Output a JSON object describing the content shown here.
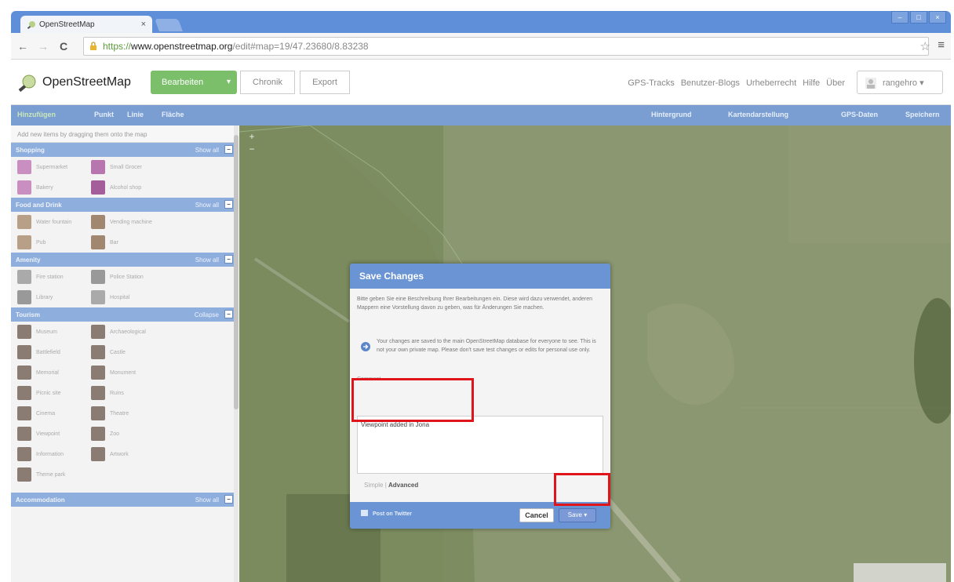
{
  "browser": {
    "tab_title": "OpenStreetMap",
    "tab_close": "×",
    "url_scheme": "https://",
    "url_domain": "www.openstreetmap.org",
    "url_rest": "/edit#map=19/47.23680/8.83238",
    "back": "←",
    "forward": "→",
    "reload": "C",
    "bookmark_star": "☆",
    "menu": "≡",
    "window_buttons": [
      "–",
      "□",
      "×"
    ]
  },
  "osm_header": {
    "brand": "OpenStreetMap",
    "edit_label": "Bearbeiten",
    "edit_caret": "▾",
    "history_label": "Chronik",
    "export_label": "Export",
    "links": [
      "GPS-Tracks",
      "Benutzer-Blogs",
      "Urheberrecht",
      "Hilfe",
      "Über"
    ],
    "user": "rangehro ▾"
  },
  "editor_bar": {
    "left": [
      "Hinzufügen",
      "Punkt",
      "Linie",
      "Fläche"
    ],
    "right": [
      "Hintergrund",
      "Kartendarstellung",
      "GPS-Daten",
      "Speichern"
    ]
  },
  "sidebar": {
    "hint": "Add new items by dragging them onto the map",
    "show_all": "Show all",
    "collapse": "−",
    "categories": [
      {
        "name": "Shopping",
        "items": [
          [
            "Supermarket",
            "Small Grocer"
          ],
          [
            "Bakery",
            "Alcohol shop"
          ]
        ]
      },
      {
        "name": "Food and Drink",
        "items": [
          [
            "Water fountain",
            "Vending machine"
          ],
          [
            "Pub",
            "Bar"
          ]
        ]
      },
      {
        "name": "Amenity",
        "items": [
          [
            "Fire station",
            "Police Station"
          ],
          [
            "Library",
            "Hospital"
          ]
        ]
      },
      {
        "name": "Tourism",
        "show": "Collapse",
        "items": [
          [
            "Museum",
            "Archaeological"
          ],
          [
            "Battlefield",
            "Castle"
          ],
          [
            "Memorial",
            "Monument"
          ],
          [
            "Picnic site",
            "Ruins"
          ],
          [
            "Cinema",
            "Theatre"
          ],
          [
            "Viewpoint",
            "Zoo"
          ],
          [
            "Information",
            "Artwork"
          ],
          [
            "Theme park",
            ""
          ]
        ]
      },
      {
        "name": "Accommodation",
        "items": []
      }
    ]
  },
  "map": {
    "zoom_in": "+",
    "zoom_out": "−"
  },
  "dialog": {
    "title": "Save Changes",
    "description": "Bitte geben Sie eine Beschreibung Ihrer Bearbeitungen ein. Diese wird dazu verwendet, anderen Mappern eine Vorstellung davon zu geben, was für Änderungen Sie machen.",
    "info": "Your changes are saved to the main OpenStreetMap database for everyone to see. This is not your own private map. Please don't save test changes or edits for personal use only.",
    "comment_label": "Comment",
    "comment_value": "Viewpoint added in Jona",
    "tab_simple": "Simple",
    "tab_sep": "|",
    "tab_advanced": "Advanced",
    "twitter": "Post on Twitter",
    "cancel": "Cancel",
    "save": "Save ▾"
  },
  "colors": {
    "accent_green": "#7bbf6b",
    "editor_blue": "#7a9ed1",
    "highlight_red": "#e0151c"
  }
}
